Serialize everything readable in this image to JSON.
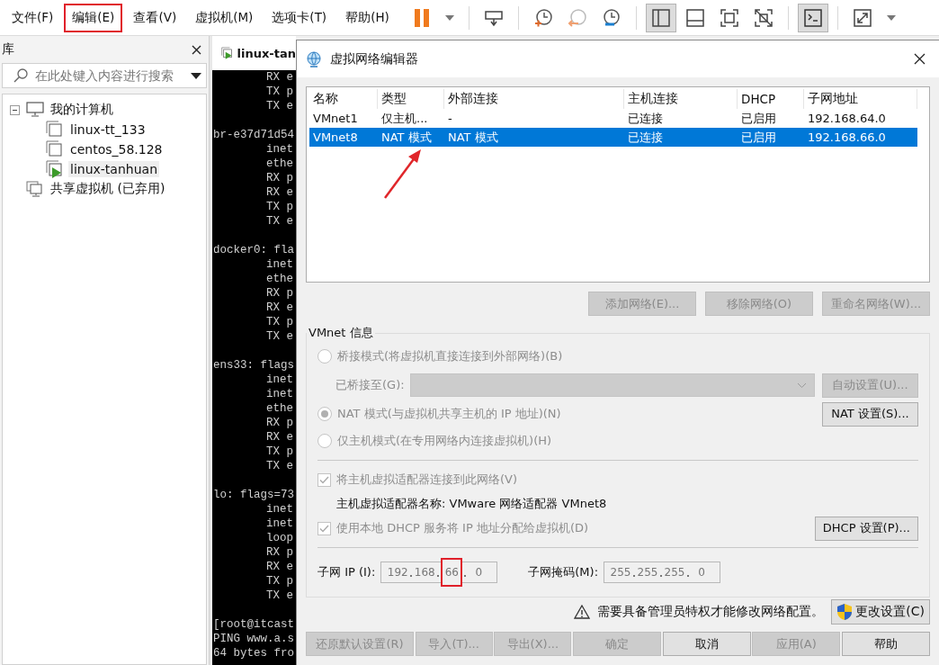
{
  "menu_bar": {
    "items": [
      {
        "label": "文件(F)",
        "annotated": false
      },
      {
        "label": "编辑(E)",
        "annotated": true
      },
      {
        "label": "查看(V)",
        "annotated": false
      },
      {
        "label": "虚拟机(M)",
        "annotated": false
      },
      {
        "label": "选项卡(T)",
        "annotated": false
      },
      {
        "label": "帮助(H)",
        "annotated": false
      }
    ],
    "toolbar": [
      {
        "kind": "pause"
      },
      {
        "kind": "dropdown"
      },
      {
        "kind": "separator"
      },
      {
        "kind": "send-keys"
      },
      {
        "kind": "separator"
      },
      {
        "kind": "snapshot"
      },
      {
        "kind": "revert"
      },
      {
        "kind": "snapshot-manager"
      },
      {
        "kind": "separator"
      },
      {
        "kind": "sidebar",
        "pressed": true
      },
      {
        "kind": "thumbnail",
        "pressed": false
      },
      {
        "kind": "fullscreen",
        "pressed": false
      },
      {
        "kind": "unity",
        "pressed": false
      },
      {
        "kind": "separator"
      },
      {
        "kind": "console",
        "pressed": true
      },
      {
        "kind": "separator"
      },
      {
        "kind": "stretch"
      },
      {
        "kind": "dropdown"
      }
    ]
  },
  "library": {
    "title": "库",
    "search": {
      "placeholder": "在此处键入内容进行搜索"
    },
    "tree": [
      {
        "label": "我的计算机",
        "kind": "computer",
        "expanded": true,
        "selected": false,
        "children": [
          {
            "label": "linux-tt_133",
            "kind": "vm",
            "running": false,
            "selected": false
          },
          {
            "label": "centos_58.128",
            "kind": "vm",
            "running": false,
            "selected": false
          },
          {
            "label": "linux-tanhuan",
            "kind": "vm",
            "running": true,
            "selected": true
          }
        ]
      },
      {
        "label": "共享虚拟机 (已弃用)",
        "kind": "shared",
        "selected": false
      }
    ]
  },
  "vm_tab": {
    "label": "linux-tan",
    "running": true
  },
  "terminal": {
    "blocks": [
      {
        "kind": "interface",
        "lines": [
          "RX e",
          "TX p",
          "TX e"
        ]
      },
      {
        "kind": "interface",
        "header": "br-e37d71d54",
        "lines": [
          "inet",
          "ethe",
          "RX p",
          "RX e",
          "TX p",
          "TX e"
        ]
      },
      {
        "kind": "interface",
        "header": "docker0: fla",
        "lines": [
          "inet",
          "ethe",
          "RX p",
          "RX e",
          "TX p",
          "TX e"
        ]
      },
      {
        "kind": "interface",
        "header": "ens33: flags",
        "lines": [
          "inet",
          "inet",
          "ethe",
          "RX p",
          "RX e",
          "TX p",
          "TX e"
        ]
      },
      {
        "kind": "interface",
        "header": "lo: flags=73",
        "lines": [
          "inet",
          "inet",
          "loop",
          "RX p",
          "RX e",
          "TX p",
          "TX e"
        ]
      },
      {
        "kind": "output",
        "lines": [
          "[root@itcast",
          "PING www.a.s",
          "64 bytes fro"
        ]
      }
    ]
  },
  "dialog": {
    "title": "虚拟网络编辑器",
    "table": {
      "columns": [
        "名称",
        "类型",
        "外部连接",
        "主机连接",
        "DHCP",
        "子网地址"
      ],
      "rows": [
        {
          "cells": [
            "VMnet1",
            "仅主机...",
            "-",
            "已连接",
            "已启用",
            "192.168.64.0"
          ],
          "selected": false,
          "annotated": false
        },
        {
          "cells": [
            "VMnet8",
            "NAT 模式",
            "NAT 模式",
            "已连接",
            "已启用",
            "192.168.66.0"
          ],
          "selected": true,
          "annotated": true
        }
      ]
    },
    "table_buttons": [
      {
        "label": "添加网络(E)...",
        "disabled": true
      },
      {
        "label": "移除网络(O)",
        "disabled": true
      },
      {
        "label": "重命名网络(W)...",
        "disabled": true
      }
    ],
    "vmnet_info": {
      "title": "VMnet 信息",
      "bridged_mode": {
        "label": "桥接模式(将虚拟机直接连接到外部网络)(B)",
        "selected": false,
        "disabled": true
      },
      "bridged_to": {
        "label": "已桥接至(G):",
        "disabled": true
      },
      "auto_button": {
        "label": "自动设置(U)...",
        "disabled": true
      },
      "nat_mode": {
        "label": "NAT 模式(与虚拟机共享主机的 IP 地址)(N)",
        "selected": true,
        "disabled": true
      },
      "nat_button": {
        "label": "NAT 设置(S)...",
        "disabled": false
      },
      "host_only_mode": {
        "label": "仅主机模式(在专用网络内连接虚拟机)(H)",
        "selected": false,
        "disabled": true
      },
      "connect_adapter": {
        "label": "将主机虚拟适配器连接到此网络(V)",
        "checked": true,
        "disabled": true
      },
      "adapter_name": "主机虚拟适配器名称: VMware 网络适配器 VMnet8",
      "dhcp": {
        "label": "使用本地 DHCP 服务将 IP 地址分配给虚拟机(D)",
        "checked": true,
        "disabled": true
      },
      "dhcp_button": {
        "label": "DHCP 设置(P)...",
        "disabled": false
      },
      "subnet_ip": {
        "label": "子网 IP (I):",
        "octets": [
          {
            "value": "192",
            "annotated": false
          },
          {
            "value": "168",
            "annotated": false
          },
          {
            "value": "66",
            "annotated": true
          },
          {
            "value": "0",
            "annotated": false
          }
        ]
      },
      "subnet_mask": {
        "label": "子网掩码(M):",
        "octets": [
          {
            "value": "255",
            "annotated": false
          },
          {
            "value": "255",
            "annotated": false
          },
          {
            "value": "255",
            "annotated": false
          },
          {
            "value": "0",
            "annotated": false
          }
        ]
      }
    },
    "notice": {
      "text": "需要具备管理员特权才能修改网络配置。",
      "button": "更改设置(C)"
    },
    "footer_buttons": [
      {
        "label": "还原默认设置(R)",
        "disabled": true
      },
      {
        "label": "导入(T)...",
        "disabled": true
      },
      {
        "label": "导出(X)...",
        "disabled": true
      },
      {
        "label": "确定",
        "disabled": true
      },
      {
        "label": "取消",
        "disabled": false
      },
      {
        "label": "应用(A)",
        "disabled": true
      },
      {
        "label": "帮助",
        "disabled": false
      }
    ]
  }
}
